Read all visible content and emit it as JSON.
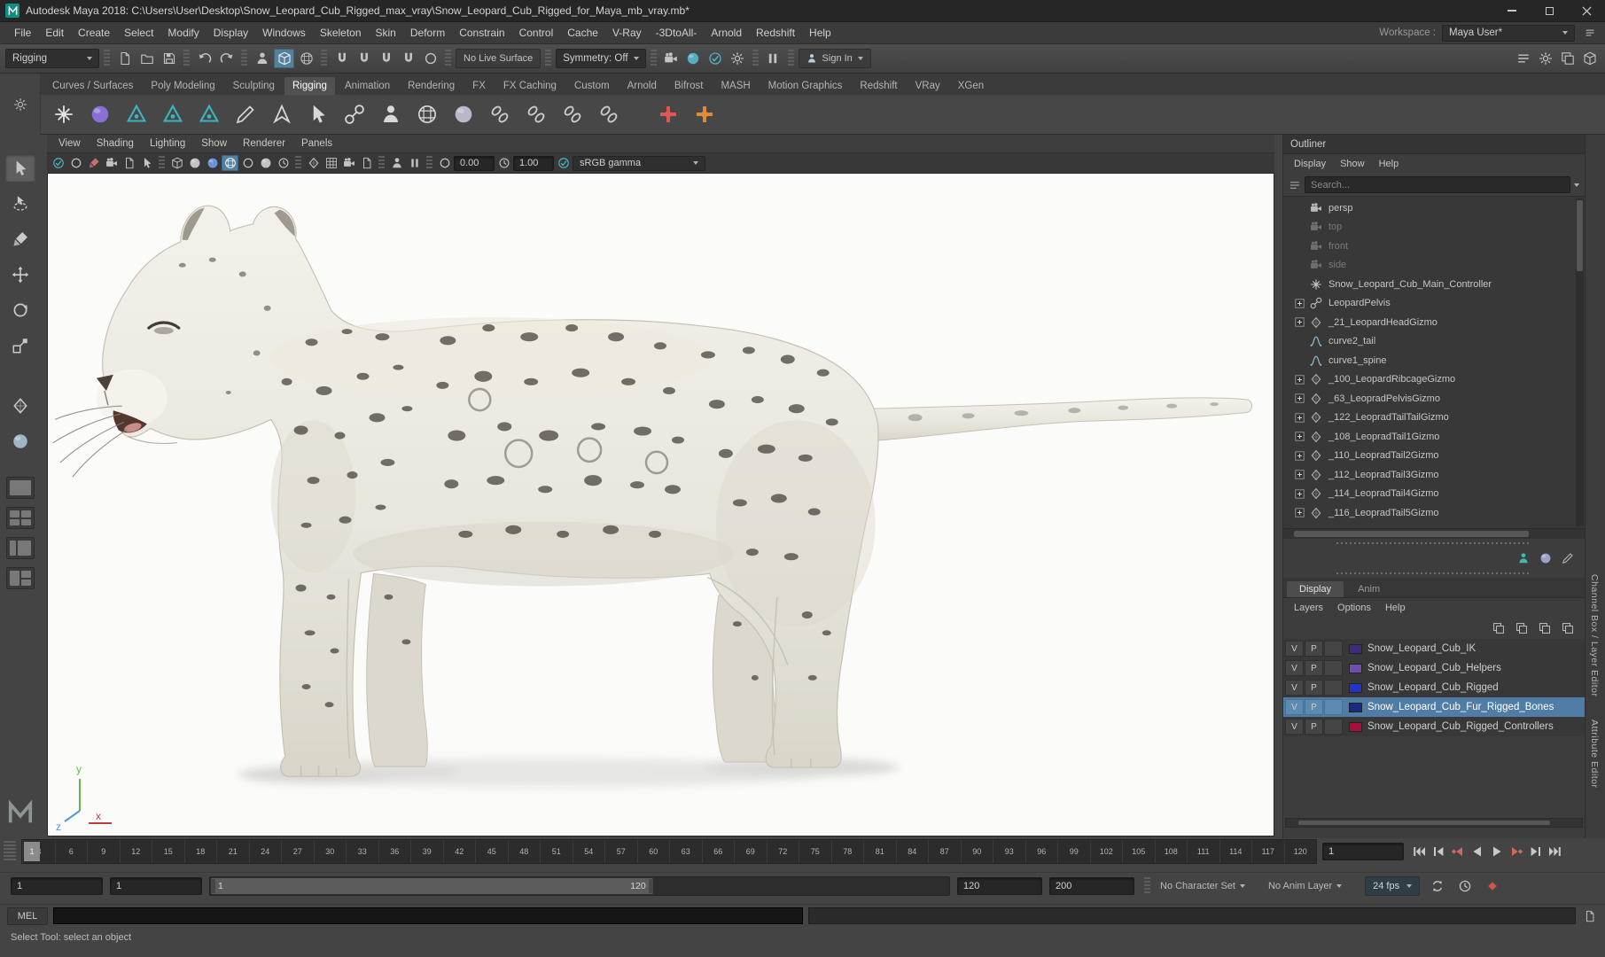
{
  "window": {
    "title": "Autodesk Maya 2018: C:\\Users\\User\\Desktop\\Snow_Leopard_Cub_Rigged_max_vray\\Snow_Leopard_Cub_Rigged_for_Maya_mb_vray.mb*"
  },
  "menu_bar": {
    "items": [
      "File",
      "Edit",
      "Create",
      "Select",
      "Modify",
      "Display",
      "Windows",
      "Skeleton",
      "Skin",
      "Deform",
      "Constrain",
      "Control",
      "Cache",
      "V-Ray",
      "-3DtoAll-",
      "Arnold",
      "Redshift",
      "Help"
    ],
    "workspace_label": "Workspace :",
    "workspace_value": "Maya User*"
  },
  "status_line": {
    "menu_set": "Rigging",
    "no_live_surface": "No Live Surface",
    "symmetry": "Symmetry: Off",
    "sign_in": "Sign In"
  },
  "shelf": {
    "tabs": [
      "Curves / Surfaces",
      "Poly Modeling",
      "Sculpting",
      "Rigging",
      "Animation",
      "Rendering",
      "FX",
      "FX Caching",
      "Custom",
      "Arnold",
      "Bifrost",
      "MASH",
      "Motion Graphics",
      "Redshift",
      "VRay",
      "XGen"
    ],
    "active_tab": "Rigging"
  },
  "viewport": {
    "menus": [
      "View",
      "Shading",
      "Lighting",
      "Show",
      "Renderer",
      "Panels"
    ],
    "exposure": "0.00",
    "gamma": "1.00",
    "color_space": "sRGB gamma",
    "axis_x": "x",
    "axis_y": "y",
    "axis_z": "z"
  },
  "outliner": {
    "title": "Outliner",
    "menus": [
      "Display",
      "Show",
      "Help"
    ],
    "search_placeholder": "Search...",
    "items": [
      {
        "label": "persp",
        "icon": "camera",
        "dimmed": false,
        "expandable": false
      },
      {
        "label": "top",
        "icon": "camera",
        "dimmed": true,
        "expandable": false
      },
      {
        "label": "front",
        "icon": "camera",
        "dimmed": true,
        "expandable": false
      },
      {
        "label": "side",
        "icon": "camera",
        "dimmed": true,
        "expandable": false
      },
      {
        "label": "Snow_Leopard_Cub_Main_Controller",
        "icon": "controller",
        "dimmed": false,
        "expandable": false
      },
      {
        "label": "LeopardPelvis",
        "icon": "joint",
        "dimmed": false,
        "expandable": true
      },
      {
        "label": "_21_LeopardHeadGizmo",
        "icon": "gizmo",
        "dimmed": false,
        "expandable": true
      },
      {
        "label": "curve2_tail",
        "icon": "curve",
        "dimmed": false,
        "expandable": false
      },
      {
        "label": "curve1_spine",
        "icon": "curve",
        "dimmed": false,
        "expandable": false
      },
      {
        "label": "_100_LeopardRibcageGizmo",
        "icon": "gizmo",
        "dimmed": false,
        "expandable": true
      },
      {
        "label": "_63_LeopradPelvisGizmo",
        "icon": "gizmo",
        "dimmed": false,
        "expandable": true
      },
      {
        "label": "_122_LeopradTailTailGizmo",
        "icon": "gizmo",
        "dimmed": false,
        "expandable": true
      },
      {
        "label": "_108_LeopradTail1Gizmo",
        "icon": "gizmo",
        "dimmed": false,
        "expandable": true
      },
      {
        "label": "_110_LeopradTail2Gizmo",
        "icon": "gizmo",
        "dimmed": false,
        "expandable": true
      },
      {
        "label": "_112_LeopradTail3Gizmo",
        "icon": "gizmo",
        "dimmed": false,
        "expandable": true
      },
      {
        "label": "_114_LeopradTail4Gizmo",
        "icon": "gizmo",
        "dimmed": false,
        "expandable": true
      },
      {
        "label": "_116_LeopradTail5Gizmo",
        "icon": "gizmo",
        "dimmed": false,
        "expandable": true
      }
    ]
  },
  "layer_editor": {
    "tabs": [
      "Display",
      "Anim"
    ],
    "active_tab": "Display",
    "menus": [
      "Layers",
      "Options",
      "Help"
    ],
    "layers": [
      {
        "v": "V",
        "p": "P",
        "color": "#3f2a7d",
        "name": "Snow_Leopard_Cub_IK",
        "selected": false
      },
      {
        "v": "V",
        "p": "P",
        "color": "#6f4fae",
        "name": "Snow_Leopard_Cub_Helpers",
        "selected": false
      },
      {
        "v": "V",
        "p": "P",
        "color": "#2433cc",
        "name": "Snow_Leopard_Cub_Rigged",
        "selected": false
      },
      {
        "v": "V",
        "p": "P",
        "color": "#1b2a80",
        "name": "Snow_Leopard_Cub_Fur_Rigged_Bones",
        "selected": true
      },
      {
        "v": "V",
        "p": "P",
        "color": "#a8103c",
        "name": "Snow_Leopard_Cub_Rigged_Controllers",
        "selected": false
      }
    ]
  },
  "side_tabs": {
    "channel_box": "Channel Box / Layer Editor",
    "attribute_editor": "Attribute Editor"
  },
  "timeline": {
    "ticks": [
      "3",
      "6",
      "9",
      "12",
      "15",
      "18",
      "21",
      "24",
      "27",
      "30",
      "33",
      "36",
      "39",
      "42",
      "45",
      "48",
      "51",
      "54",
      "57",
      "60",
      "63",
      "66",
      "69",
      "72",
      "75",
      "78",
      "81",
      "84",
      "87",
      "90",
      "93",
      "96",
      "99",
      "102",
      "105",
      "108",
      "111",
      "114",
      "117",
      "120"
    ],
    "current_frame": "1",
    "current_time": "1"
  },
  "range_slider": {
    "anim_start": "1",
    "playback_start": "1",
    "range_label_start": "1",
    "range_label_end": "120",
    "playback_end": "120",
    "anim_end": "200",
    "character_set": "No Character Set",
    "anim_layer": "No Anim Layer",
    "fps": "24 fps"
  },
  "command_line": {
    "label": "MEL"
  },
  "help_line": {
    "text": "Select Tool: select an object"
  },
  "colors": {
    "accent": "#55809c",
    "selection": "#507da6",
    "viewport_bg": "#fbfbfa"
  },
  "icons": {
    "window_controls": [
      "minimize",
      "maximize",
      "close"
    ],
    "status_line": [
      "new-scene",
      "open-scene",
      "save-scene",
      "undo",
      "redo",
      "select-hierarchy",
      "select-object",
      "select-component",
      "snap-grid",
      "snap-curve",
      "snap-point",
      "snap-plane",
      "make-live",
      "render-view",
      "ipr-render",
      "render-settings",
      "pause-viewport",
      "sign-in-user",
      "attribute-editor-toggle",
      "tool-settings-toggle",
      "channel-box-toggle",
      "modeling-toolkit-toggle"
    ],
    "playback": [
      "go-to-start",
      "step-back-frame",
      "step-back-key",
      "play-backwards",
      "play-forwards",
      "step-forward-key",
      "step-forward-frame",
      "go-to-end"
    ],
    "range_row": [
      "playback-loop",
      "playback-speed",
      "auto-keyframe"
    ]
  }
}
